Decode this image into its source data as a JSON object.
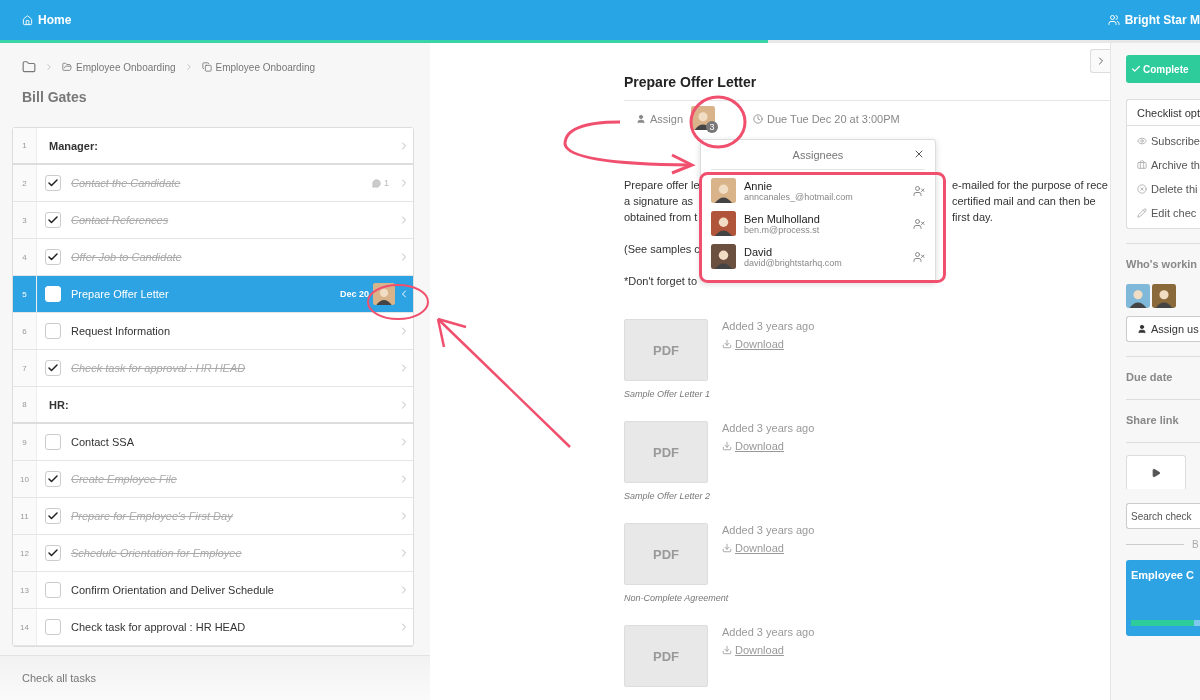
{
  "topbar": {
    "home": "Home",
    "organization": "Bright Star M",
    "progress": {
      "level": 0.64
    }
  },
  "left": {
    "breadcrumb": [
      "Employee Onboarding",
      "Employee Onboarding"
    ],
    "title": "Bill Gates",
    "tasks": [
      {
        "kind": "heading",
        "number": "1",
        "label": "Manager:"
      },
      {
        "kind": "task",
        "number": "2",
        "label": "Contact the Candidate",
        "checked": true,
        "selected": false,
        "comments": "1"
      },
      {
        "kind": "task",
        "number": "3",
        "label": "Contact References",
        "checked": true,
        "selected": false
      },
      {
        "kind": "task",
        "number": "4",
        "label": "Offer Job to Candidate",
        "checked": true,
        "selected": false
      },
      {
        "kind": "task",
        "number": "5",
        "label": "Prepare Offer Letter",
        "checked": false,
        "selected": true,
        "due": "Dec 20"
      },
      {
        "kind": "task",
        "number": "6",
        "label": "Request Information",
        "checked": false,
        "selected": false
      },
      {
        "kind": "task",
        "number": "7",
        "label": "Check task for approval : HR HEAD",
        "checked": true,
        "selected": false
      },
      {
        "kind": "heading",
        "number": "8",
        "label": "HR:"
      },
      {
        "kind": "task",
        "number": "9",
        "label": "Contact SSA",
        "checked": false,
        "selected": false
      },
      {
        "kind": "task",
        "number": "10",
        "label": "Create Employee File",
        "checked": true,
        "selected": false
      },
      {
        "kind": "task",
        "number": "11",
        "label": "Prepare for Employee's First Day",
        "checked": true,
        "selected": false
      },
      {
        "kind": "task",
        "number": "12",
        "label": "Schedule Orientation for Employee",
        "checked": true,
        "selected": false
      },
      {
        "kind": "task",
        "number": "13",
        "label": "Confirm Orientation and Deliver Schedule",
        "checked": false,
        "selected": false
      },
      {
        "kind": "task",
        "number": "14",
        "label": "Check task for approval : HR HEAD",
        "checked": false,
        "selected": false
      }
    ],
    "footer": "Check all tasks"
  },
  "task": {
    "title": "Prepare Offer Letter",
    "assign": "Assign",
    "assignee_count": "3",
    "due": "Due Tue Dec 20 at 3:00PM",
    "description": [
      [
        {
          "left": "Prepare offer le",
          "right": "e-mailed for the purpose of rece"
        },
        {
          "left": "a signature as",
          "right": "certified mail and can then be"
        },
        {
          "left": "obtained from t",
          "right": "first day."
        }
      ],
      [
        {
          "left": "(See samples c"
        }
      ],
      [
        {
          "left": "*Don't forget to"
        }
      ]
    ],
    "attachments": [
      {
        "thumb": "PDF",
        "added": "Added 3 years ago",
        "link": "Download",
        "caption": "Sample Offer Letter 1"
      },
      {
        "thumb": "PDF",
        "added": "Added 3 years ago",
        "link": "Download",
        "caption": "Sample Offer Letter 2"
      },
      {
        "thumb": "PDF",
        "added": "Added 3 years ago",
        "link": "Download",
        "caption": "Non-Complete Agreement"
      },
      {
        "thumb": "PDF",
        "added": "Added 3 years ago",
        "link": "Download"
      }
    ]
  },
  "assignees_popover": {
    "title": "Assignees",
    "people": [
      {
        "name": "Annie",
        "email": "anncanales_@hotmail.com"
      },
      {
        "name": "Ben Mulholland",
        "email": "ben.m@process.st"
      },
      {
        "name": "David",
        "email": "david@brightstarhq.com"
      }
    ]
  },
  "right": {
    "complete": "Complete",
    "options_title": "Checklist opt",
    "options": [
      {
        "kind": "subscribe",
        "label": "Subscribe"
      },
      {
        "kind": "archive",
        "label": "Archive th"
      },
      {
        "kind": "delete",
        "label": "Delete thi"
      },
      {
        "kind": "edit",
        "label": "Edit chec"
      }
    ],
    "working_title": "Who's workin",
    "assign_button": "Assign us",
    "due_date": "Due date",
    "share_link": "Share link",
    "search": {
      "placeholder": "Search check"
    },
    "divider": "B",
    "card": {
      "title": "Employee C",
      "progress": {
        "level": 0.9
      }
    }
  }
}
